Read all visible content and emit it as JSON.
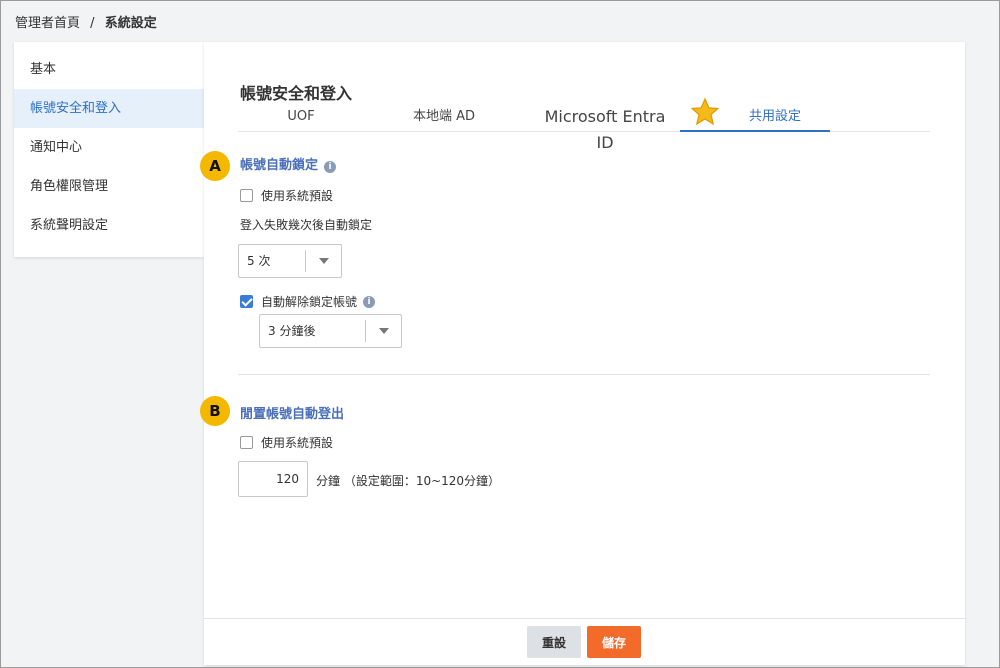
{
  "breadcrumb": {
    "home": "管理者首頁",
    "separator": "/",
    "current": "系統設定"
  },
  "sidebar": {
    "items": [
      {
        "label": "基本"
      },
      {
        "label": "帳號安全和登入"
      },
      {
        "label": "通知中心"
      },
      {
        "label": "角色權限管理"
      },
      {
        "label": "系統聲明設定"
      }
    ],
    "active_index": 1
  },
  "main": {
    "title": "帳號安全和登入",
    "tabs": [
      {
        "label": "UOF"
      },
      {
        "label": "本地端 AD"
      },
      {
        "label": "Microsoft Entra ID"
      },
      {
        "label": "共用設定"
      }
    ],
    "active_tab": 3,
    "star_icon": "star-icon"
  },
  "lockout": {
    "marker": "A",
    "title": "帳號自動鎖定",
    "info_icon": "i",
    "use_default_label": "使用系統預設",
    "use_default_checked": false,
    "attempts_label": "登入失敗幾次後自動鎖定",
    "attempts_value": "5 次",
    "auto_unlock_label": "自動解除鎖定帳號",
    "auto_unlock_checked": true,
    "unlock_value": "3 分鐘後"
  },
  "idle": {
    "marker": "B",
    "title": "閒置帳號自動登出",
    "use_default_label": "使用系統預設",
    "use_default_checked": false,
    "minutes_value": "120",
    "unit_label": "分鐘 （設定範圍：10~120分鐘）"
  },
  "footer": {
    "reset_label": "重設",
    "save_label": "儲存"
  },
  "colors": {
    "accent": "#2f6fc4",
    "section_title": "#4b70b8",
    "marker": "#f5b800",
    "save_button": "#f26b2a"
  }
}
